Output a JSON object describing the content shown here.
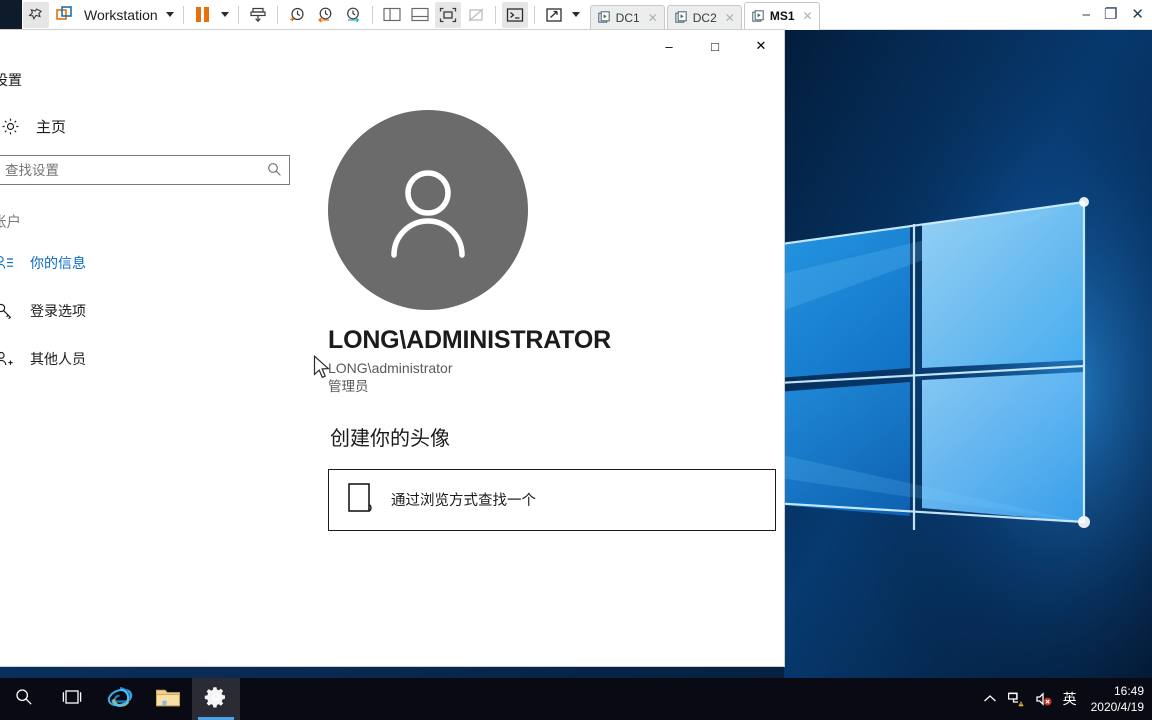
{
  "vmware": {
    "app_label": "Workstation",
    "toolbar_icons": [
      {
        "name": "pin-icon",
        "glyph": "pin"
      },
      {
        "name": "vmware-logo-icon",
        "glyph": "vmware"
      },
      {
        "name": "pause-icon",
        "glyph": "pause"
      },
      {
        "name": "send-keys-icon",
        "glyph": "send-ctrl-alt-del"
      },
      {
        "name": "take-snapshot-icon",
        "glyph": "clock-plus"
      },
      {
        "name": "revert-snapshot-icon",
        "glyph": "clock-back"
      },
      {
        "name": "snapshot-manager-icon",
        "glyph": "clock-wrench"
      },
      {
        "name": "show-library-icon",
        "glyph": "panel-left"
      },
      {
        "name": "show-thumbnails-icon",
        "glyph": "panel-bottom"
      },
      {
        "name": "show-console-icon",
        "glyph": "console-full"
      },
      {
        "name": "hide-console-icon",
        "glyph": "console-off"
      },
      {
        "name": "terminal-icon",
        "glyph": "terminal"
      },
      {
        "name": "fullscreen-icon",
        "glyph": "expand"
      }
    ],
    "tabs": [
      {
        "label": "DC1",
        "active": false
      },
      {
        "label": "DC2",
        "active": false
      },
      {
        "label": "MS1",
        "active": true
      }
    ],
    "window_controls": {
      "minimize": "minimize-icon",
      "restore": "restore-icon",
      "close": "close-icon"
    }
  },
  "settings_window": {
    "title": "设置",
    "controls": {
      "minimize": "–",
      "maximize": "□",
      "close": "✕"
    },
    "sidebar": {
      "home_label": "主页",
      "search": {
        "value": "",
        "placeholder": "查找设置"
      },
      "section_header": "帐户",
      "items": [
        {
          "label": "你的信息",
          "icon": "account-info-icon",
          "active": true
        },
        {
          "label": "登录选项",
          "icon": "key-icon",
          "active": false
        },
        {
          "label": "其他人员",
          "icon": "add-user-icon",
          "active": false
        }
      ]
    },
    "main": {
      "avatar_icon": "user-avatar-icon",
      "account_name": "LONG\\ADMINISTRATOR",
      "account_identity": "LONG\\administrator",
      "account_role": "管理员",
      "section_title": "创建你的头像",
      "browse_button": {
        "label": "通过浏览方式查找一个",
        "icon": "browse-file-icon"
      }
    }
  },
  "taskbar": {
    "items": [
      {
        "name": "search-icon",
        "label": "",
        "active": false
      },
      {
        "name": "task-view-icon",
        "label": "",
        "active": false
      },
      {
        "name": "internet-explorer-icon",
        "label": "",
        "active": false
      },
      {
        "name": "file-explorer-icon",
        "label": "",
        "active": false
      },
      {
        "name": "settings-icon",
        "label": "",
        "active": true
      }
    ],
    "tray": {
      "chevron": "show-hidden-icons-icon",
      "network": "network-warning-icon",
      "volume": "volume-muted-icon",
      "ime": "英"
    },
    "clock": {
      "time": "16:49",
      "date": "2020/4/19"
    }
  },
  "colors": {
    "accent_blue": "#0a6cc4",
    "taskbar_bg": "#0a0a14",
    "avatar_gray": "#6b6b6b",
    "vmware_orange": "#e8700a"
  }
}
